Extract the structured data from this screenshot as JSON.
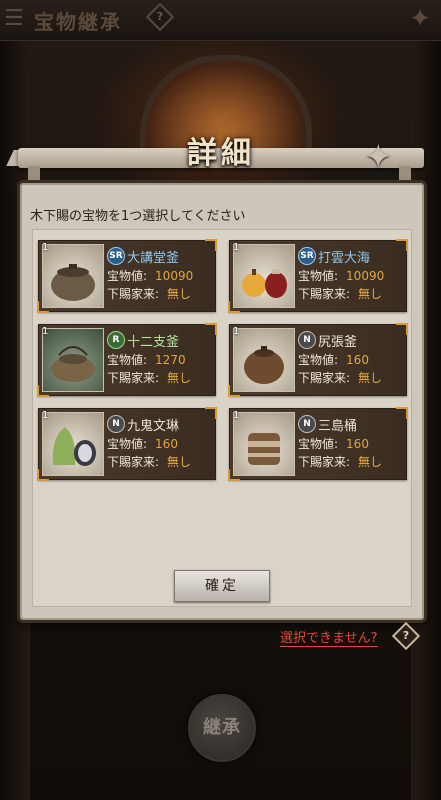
{
  "header": {
    "title": "宝物継承",
    "help": "?"
  },
  "dialog": {
    "title": "詳細",
    "instruction": "木下賜の宝物を1つ選択してください",
    "confirm_label": "確定"
  },
  "labels": {
    "value": "宝物値:",
    "retainer": "下賜家来:"
  },
  "items": [
    {
      "qty": "1",
      "rarity": "SR",
      "name": "大講堂釜",
      "value": "10090",
      "retainer": "無し",
      "icon": "kettle-icon"
    },
    {
      "qty": "1",
      "rarity": "SR",
      "name": "打雲大海",
      "value": "10090",
      "retainer": "無し",
      "icon": "tea-jars-icon"
    },
    {
      "qty": "1",
      "rarity": "R",
      "name": "十二支釜",
      "value": "1270",
      "retainer": "無し",
      "icon": "kettle-icon"
    },
    {
      "qty": "1",
      "rarity": "N",
      "name": "尻張釜",
      "value": "160",
      "retainer": "無し",
      "icon": "kettle-icon"
    },
    {
      "qty": "1",
      "rarity": "N",
      "name": "九鬼文琳",
      "value": "160",
      "retainer": "無し",
      "icon": "tea-caddy-icon"
    },
    {
      "qty": "1",
      "rarity": "N",
      "name": "三島桶",
      "value": "160",
      "retainer": "無し",
      "icon": "water-jar-icon"
    }
  ],
  "footer": {
    "cannot_select": "選択できません?",
    "help": "?",
    "inherit_label": "継承"
  },
  "colors": {
    "value_text": "#e3a741",
    "sr": "#8ec6f0",
    "r": "#b4e59c",
    "warning": "#e04a3a"
  }
}
